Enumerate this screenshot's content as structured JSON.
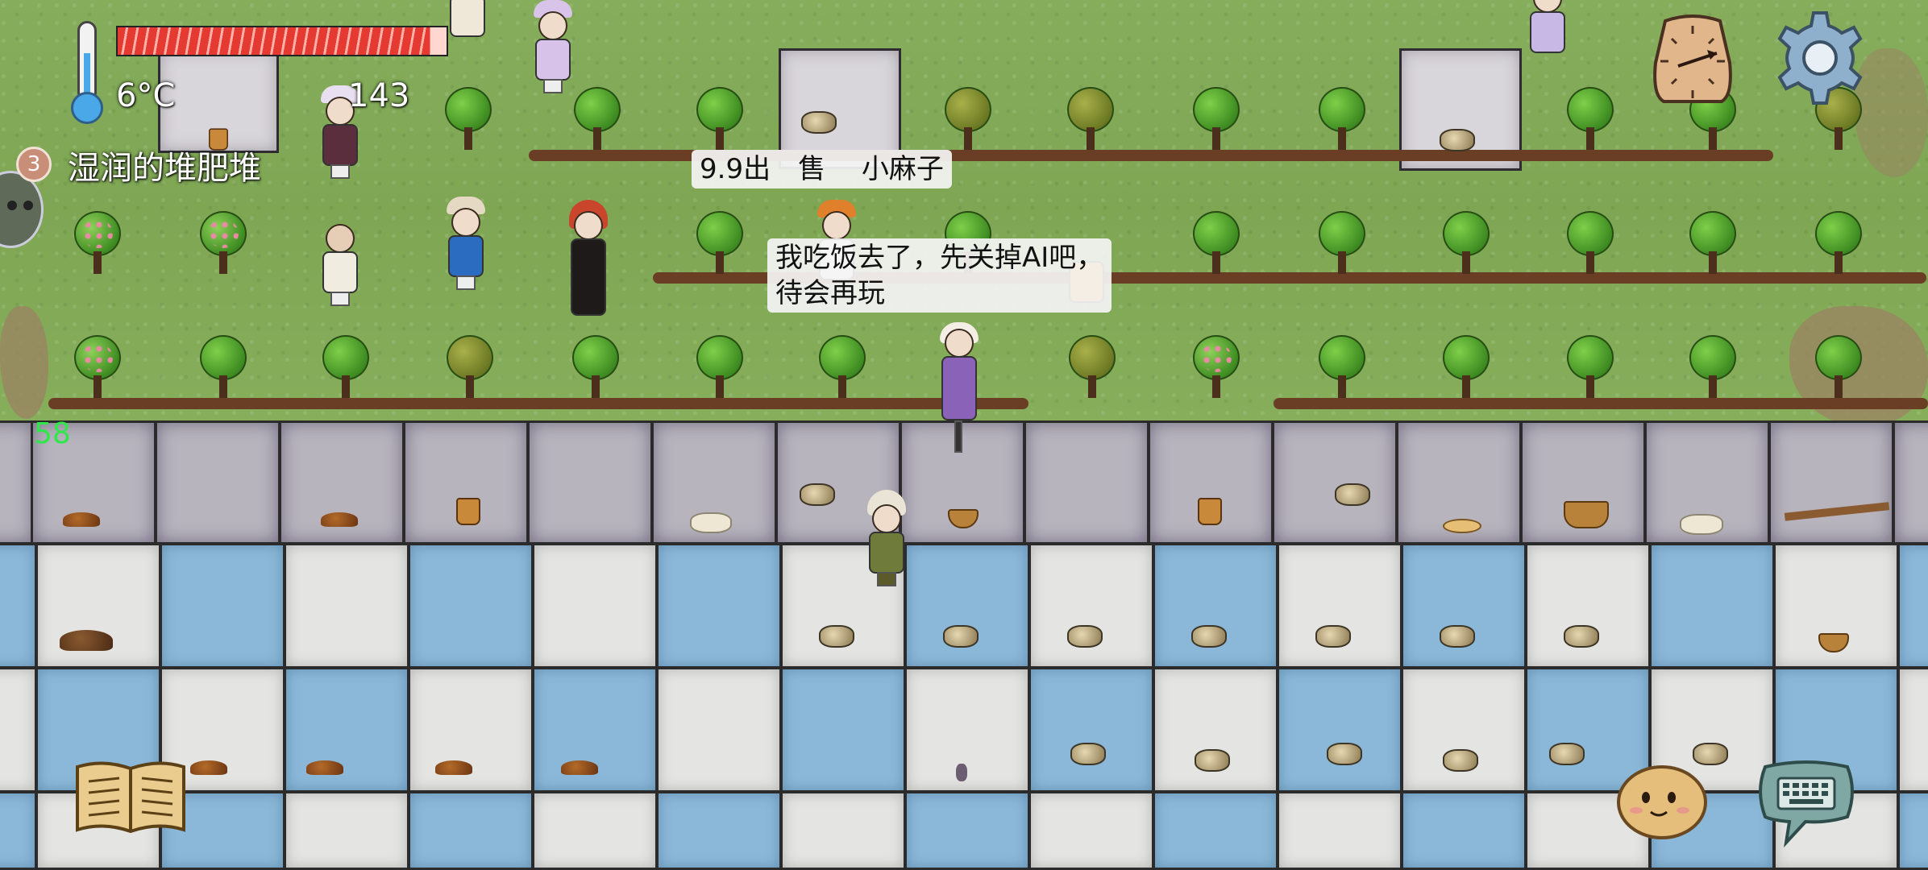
{
  "hud": {
    "temperature": "6°C",
    "temperature_value": 6,
    "food_level": 0.95,
    "age": "143",
    "holding_label": "湿润的堆肥堆",
    "holding_count": "3",
    "fps": "58"
  },
  "chat": {
    "bubble1": "9.9出　售　 小麻子",
    "bubble2": "我吃饭去了，先关掉AI吧，\n待会再玩"
  },
  "buttons": {
    "clock": "compass-clock-icon",
    "settings": "gear-icon",
    "tech_book": "book-icon",
    "emote": "emote-face-icon",
    "keyboard": "keyboard-icon"
  },
  "colors": {
    "grass": "#7ea653",
    "stone_tile": "#b7b4bd",
    "blue_tile": "#8bb8d8",
    "white_tile": "#e4e4e2",
    "food_bar": "#e53a32",
    "fps_text": "#2ee84a"
  }
}
